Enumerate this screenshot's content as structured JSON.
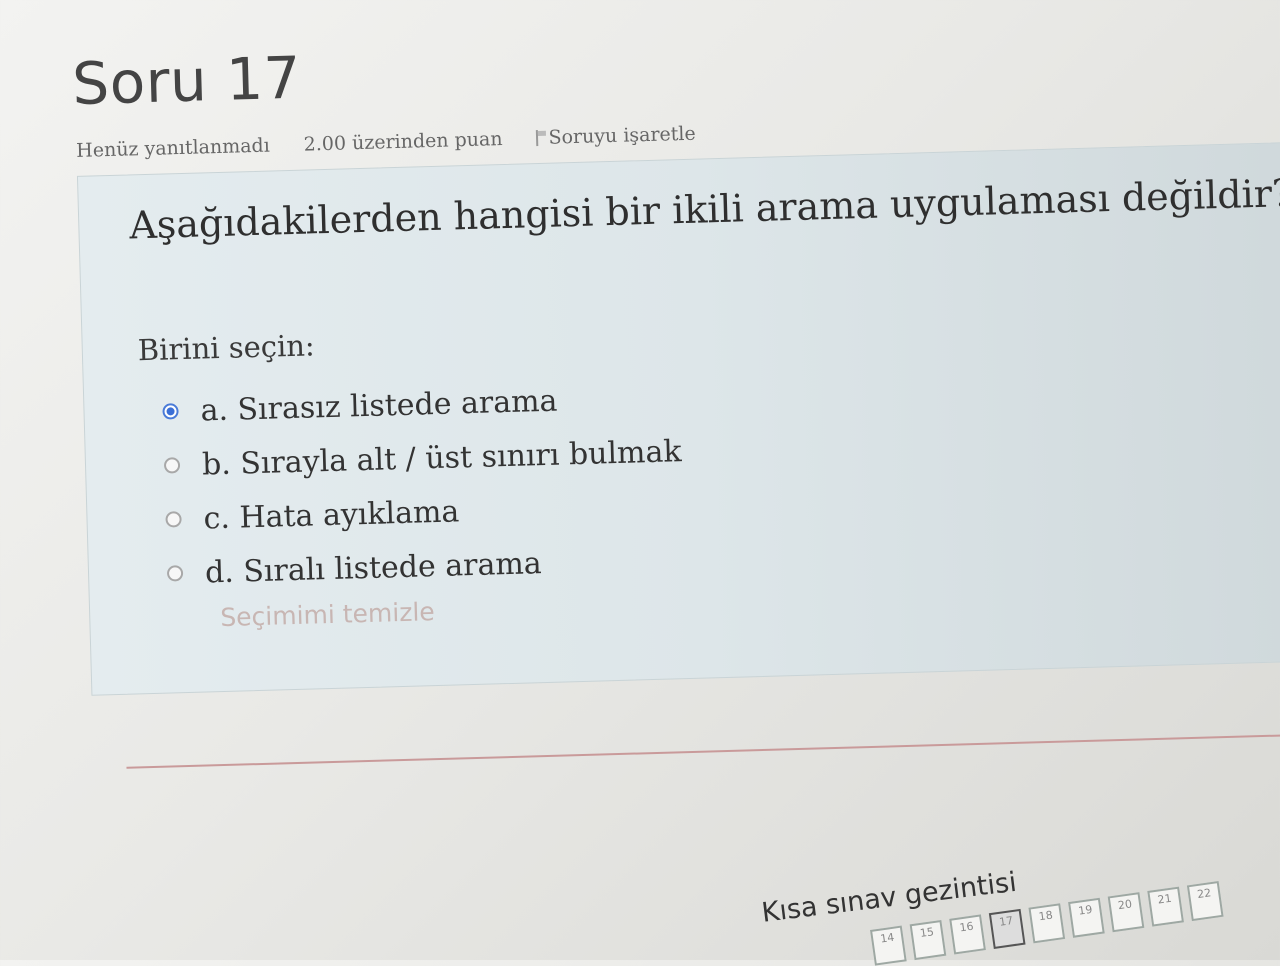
{
  "question": {
    "title": "Soru 17",
    "status": "Henüz yanıtlanmadı",
    "points": "2.00 üzerinden puan",
    "flag_label": "Soruyu işaretle",
    "text": "Aşağıdakilerden hangisi bir ikili arama uygulaması değildir?",
    "prompt": "Birini seçin:",
    "options": [
      {
        "label": "a. Sırasız listede arama",
        "selected": true
      },
      {
        "label": "b. Sırayla alt / üst sınırı bulmak",
        "selected": false
      },
      {
        "label": "c. Hata ayıklama",
        "selected": false
      },
      {
        "label": "d. Sıralı listede arama",
        "selected": false
      }
    ],
    "clear_label": "Seçimimi temizle"
  },
  "navigation": {
    "title": "Kısa sınav gezintisi",
    "buttons": [
      "14",
      "15",
      "16",
      "17",
      "18",
      "19",
      "20",
      "21",
      "22"
    ],
    "current": "17"
  },
  "colors": {
    "accent": "#3b6fd6",
    "box_bg": "#e4ecef",
    "divider": "#c99a9a"
  }
}
